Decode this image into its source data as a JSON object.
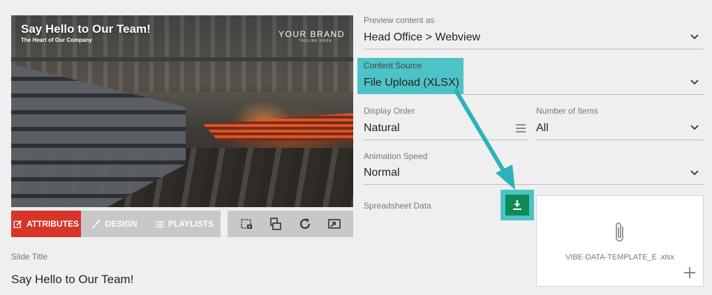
{
  "preview": {
    "slide_title": "Say Hello to Our Team!",
    "slide_subtitle": "The Heart of Our Company",
    "brand": "YOUR BRAND",
    "brand_sub": "TAGLINE HERE"
  },
  "tabs": [
    {
      "label": "ATTRIBUTES",
      "icon": "edit-icon",
      "active": true
    },
    {
      "label": "DESIGN",
      "icon": "brush-icon",
      "active": false
    },
    {
      "label": "PLAYLISTS",
      "icon": "list-icon",
      "active": false
    }
  ],
  "toolbar": [
    {
      "icon": "crop-camera-icon"
    },
    {
      "icon": "layers-icon"
    },
    {
      "icon": "refresh-icon"
    },
    {
      "icon": "expand-icon"
    }
  ],
  "slide_title_field": {
    "label": "Slide Title",
    "value": "Say Hello to Our Team!"
  },
  "preview_as": {
    "label": "Preview content as",
    "value": "Head Office > Webview"
  },
  "content_source": {
    "label": "Content Source",
    "value": "File Upload (XLSX)"
  },
  "display_order": {
    "label": "Display Order",
    "value": "Natural"
  },
  "number_of_items": {
    "label": "Number of Items",
    "value": "All"
  },
  "animation_speed": {
    "label": "Animation Speed",
    "value": "Normal"
  },
  "spreadsheet": {
    "label": "Spreadsheet Data",
    "filename": "VIBE-DATA-TEMPLATE_E .xlsx"
  },
  "colors": {
    "accent_red": "#d8352a",
    "highlight_teal": "#4ec3c7",
    "download_green": "#0e8b55"
  }
}
